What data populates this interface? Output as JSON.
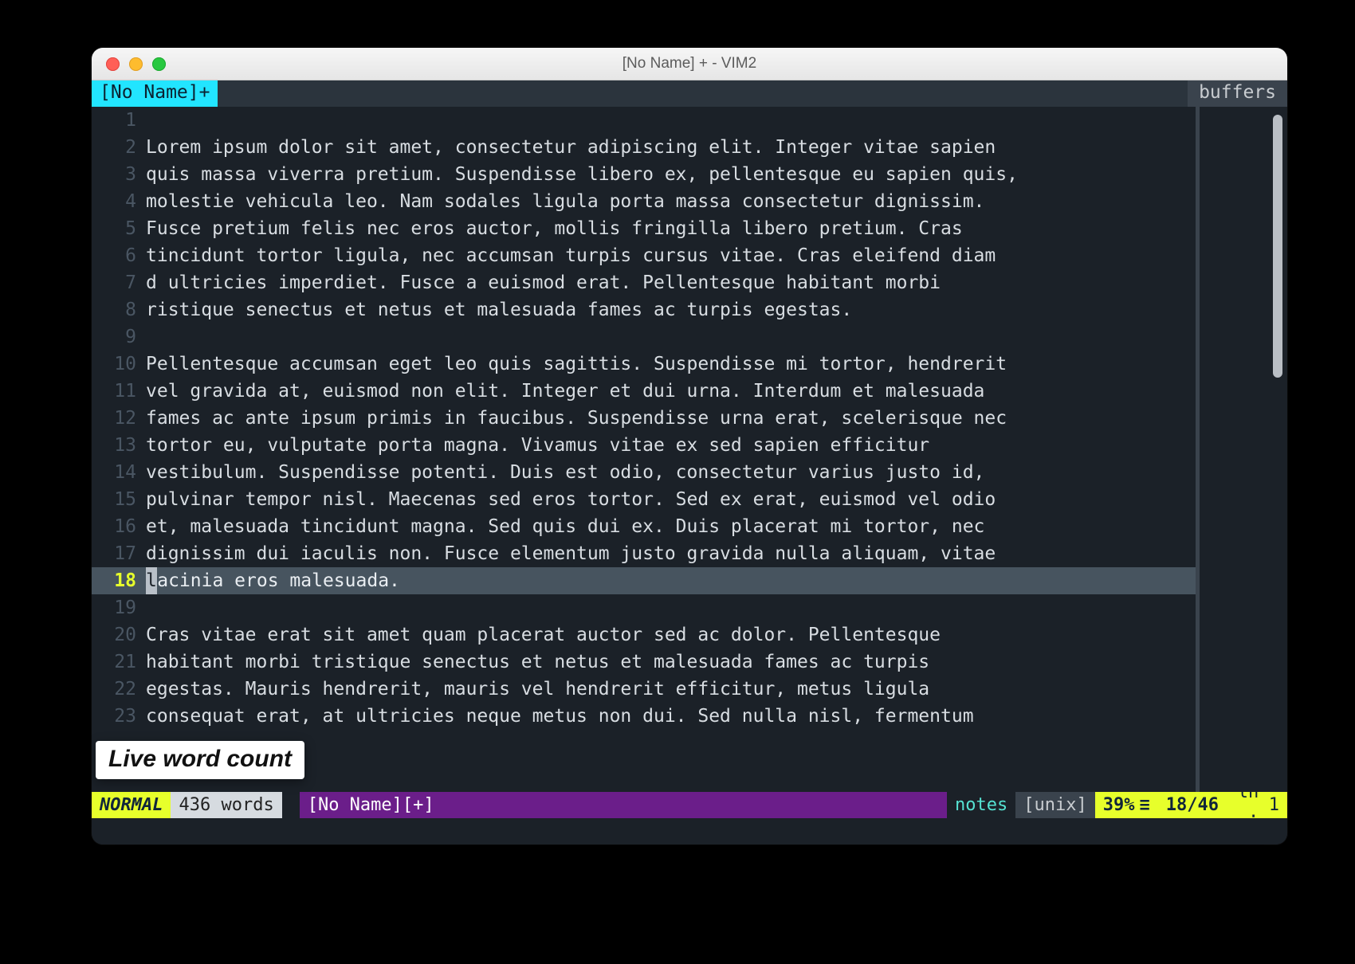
{
  "window": {
    "title": "[No Name] + - VIM2"
  },
  "tabbar": {
    "buffer_tab": "[No Name]+",
    "right_label": "buffers"
  },
  "annotation": {
    "label": "Live word count"
  },
  "status": {
    "mode": "NORMAL",
    "word_count": "436 words",
    "file_label": "[No Name][+]",
    "filetype": "notes",
    "encoding": "[unix]",
    "percent": "39%",
    "position": "18/46",
    "ln_label": "ln :",
    "col": "1"
  },
  "cursor_line": 18,
  "lines": [
    {
      "n": 1,
      "text": ""
    },
    {
      "n": 2,
      "text": "Lorem ipsum dolor sit amet, consectetur adipiscing elit. Integer vitae sapien"
    },
    {
      "n": 3,
      "text": "quis massa viverra pretium. Suspendisse libero ex, pellentesque eu sapien quis,"
    },
    {
      "n": 4,
      "text": "molestie vehicula leo. Nam sodales ligula porta massa consectetur dignissim."
    },
    {
      "n": 5,
      "text": "Fusce pretium felis nec eros auctor, mollis fringilla libero pretium. Cras"
    },
    {
      "n": 6,
      "text": "tincidunt tortor ligula, nec accumsan turpis cursus vitae. Cras eleifend diam"
    },
    {
      "n": 7,
      "text": "d ultricies imperdiet. Fusce a euismod erat. Pellentesque habitant morbi"
    },
    {
      "n": 8,
      "text": "ristique senectus et netus et malesuada fames ac turpis egestas."
    },
    {
      "n": 9,
      "text": ""
    },
    {
      "n": 10,
      "text": "Pellentesque accumsan eget leo quis sagittis. Suspendisse mi tortor, hendrerit"
    },
    {
      "n": 11,
      "text": "vel gravida at, euismod non elit. Integer et dui urna. Interdum et malesuada"
    },
    {
      "n": 12,
      "text": "fames ac ante ipsum primis in faucibus. Suspendisse urna erat, scelerisque nec"
    },
    {
      "n": 13,
      "text": "tortor eu, vulputate porta magna. Vivamus vitae ex sed sapien efficitur"
    },
    {
      "n": 14,
      "text": "vestibulum. Suspendisse potenti. Duis est odio, consectetur varius justo id,"
    },
    {
      "n": 15,
      "text": "pulvinar tempor nisl. Maecenas sed eros tortor. Sed ex erat, euismod vel odio"
    },
    {
      "n": 16,
      "text": "et, malesuada tincidunt magna. Sed quis dui ex. Duis placerat mi tortor, nec"
    },
    {
      "n": 17,
      "text": "dignissim dui iaculis non. Fusce elementum justo gravida nulla aliquam, vitae"
    },
    {
      "n": 18,
      "text": "lacinia eros malesuada."
    },
    {
      "n": 19,
      "text": ""
    },
    {
      "n": 20,
      "text": "Cras vitae erat sit amet quam placerat auctor sed ac dolor. Pellentesque"
    },
    {
      "n": 21,
      "text": "habitant morbi tristique senectus et netus et malesuada fames ac turpis"
    },
    {
      "n": 22,
      "text": "egestas. Mauris hendrerit, mauris vel hendrerit efficitur, metus ligula"
    },
    {
      "n": 23,
      "text": "consequat erat, at ultricies neque metus non dui. Sed nulla nisl, fermentum"
    }
  ]
}
